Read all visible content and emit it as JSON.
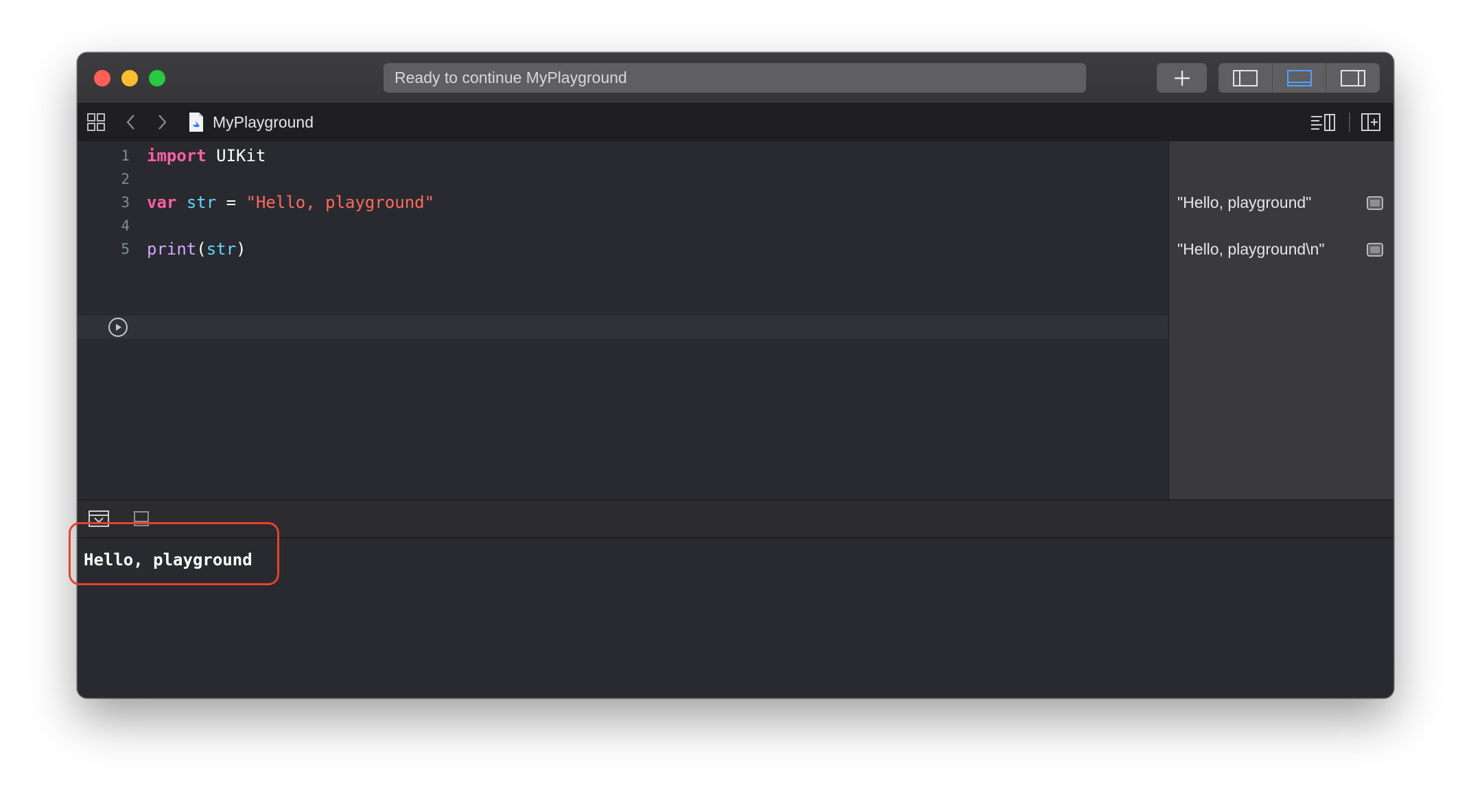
{
  "window": {
    "status_text": "Ready to continue MyPlayground"
  },
  "jumpbar": {
    "file_name": "MyPlayground"
  },
  "editor": {
    "line_numbers": [
      "1",
      "2",
      "3",
      "4",
      "5"
    ],
    "lines": [
      [
        {
          "t": "import",
          "c": "kw"
        },
        {
          "t": " UIKit",
          "c": "txt"
        }
      ],
      [],
      [
        {
          "t": "var",
          "c": "kw"
        },
        {
          "t": " ",
          "c": "txt"
        },
        {
          "t": "str",
          "c": "ident"
        },
        {
          "t": " = ",
          "c": "txt"
        },
        {
          "t": "\"Hello, playground\"",
          "c": "str"
        }
      ],
      [],
      [
        {
          "t": "print",
          "c": "fn"
        },
        {
          "t": "(",
          "c": "txt"
        },
        {
          "t": "str",
          "c": "ident"
        },
        {
          "t": ")",
          "c": "txt"
        }
      ]
    ]
  },
  "results": {
    "line3": "\"Hello, playground\"",
    "line5": "\"Hello, playground\\n\""
  },
  "console": {
    "output": "Hello, playground"
  },
  "colors": {
    "keyword": "#fc5fa3",
    "identifier": "#5dd8ff",
    "string": "#fc6a5d",
    "function": "#d0a8ff",
    "highlight": "#e8412c",
    "active_segment": "#4da3ff"
  }
}
